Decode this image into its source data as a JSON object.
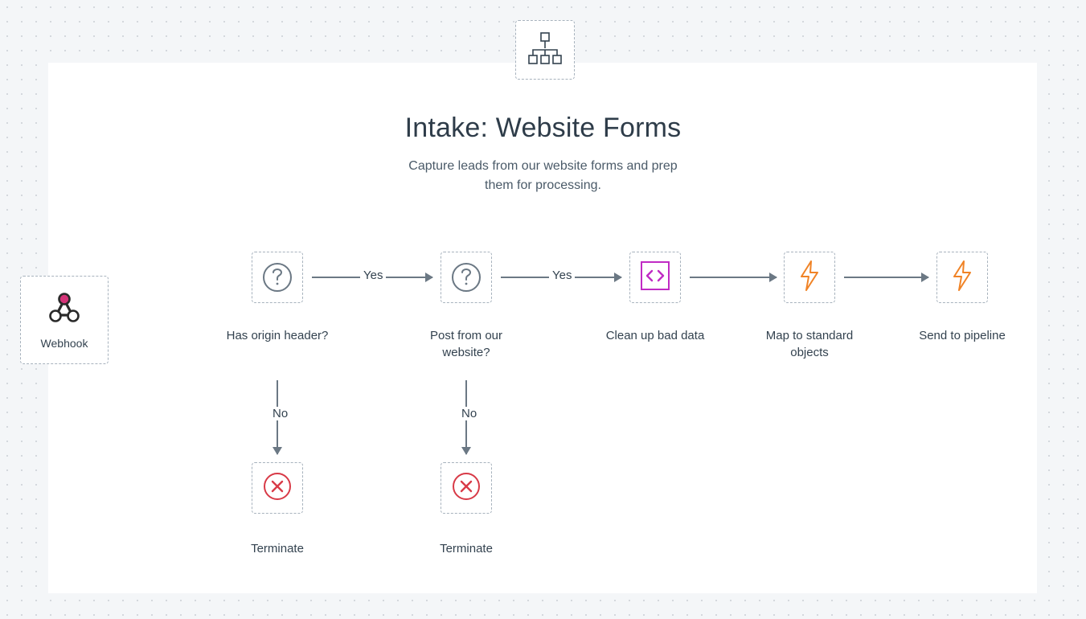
{
  "header": {
    "title": "Intake: Website Forms",
    "subtitle_line1": "Capture leads from our website forms and prep",
    "subtitle_line2": "them for processing."
  },
  "nodes": {
    "webhook": {
      "label": "Webhook"
    },
    "decision1": {
      "label": "Has origin header?"
    },
    "decision2": {
      "label": "Post from our website?"
    },
    "cleanup": {
      "label": "Clean up bad data"
    },
    "map": {
      "label": "Map to standard objects"
    },
    "send": {
      "label": "Send to pipeline"
    },
    "terminate1": {
      "label": "Terminate"
    },
    "terminate2": {
      "label": "Terminate"
    }
  },
  "edges": {
    "yes1": "Yes",
    "no1": "No",
    "yes2": "Yes",
    "no2": "No"
  },
  "colors": {
    "accentPink": "#d53378",
    "accentMagenta": "#c02bc4",
    "accentOrange": "#f08326",
    "accentRed": "#d83a47",
    "stroke": "#6b7884"
  }
}
